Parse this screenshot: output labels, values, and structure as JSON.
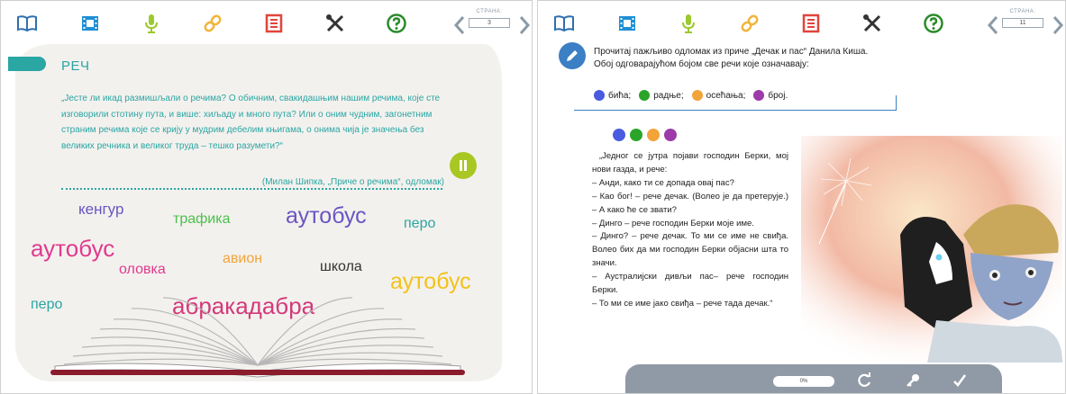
{
  "left": {
    "toolbar": {
      "icons": [
        "book-icon",
        "film-icon",
        "microphone-icon",
        "link-icon",
        "document-icon",
        "tools-icon",
        "help-icon"
      ],
      "colors": {
        "book": "#2e6fb0",
        "film": "#1e8fd6",
        "mic": "#9cc92e",
        "link": "#f2b43a",
        "doc": "#e2443a",
        "tools": "#333333",
        "help": "#2a8a2a"
      },
      "pager_label": "СТРАНА:",
      "pager_value": "3"
    },
    "section_title": "РЕЧ",
    "quote": "„Јесте ли икад размишљали о речима? О обичним, свакидашњим нашим речима, које сте изговорили стотину пута, и више: хиљаду и много пута? Или о оним чудним, загонетним страним речима које се крију у мудрим дебелим књигама, о онима чија је значења без великих речника и великог труда – тешко разумети?“",
    "attribution": "(Милан Шипка, „Приче о речима“, одломак)",
    "words": [
      {
        "text": "кенгур",
        "color": "#6a55c2"
      },
      {
        "text": "трафика",
        "color": "#4cc04c"
      },
      {
        "text": "аутобус",
        "color": "#6a55c2"
      },
      {
        "text": "перо",
        "color": "#2aa6a3"
      },
      {
        "text": "аутобус",
        "color": "#e03a8e"
      },
      {
        "text": "авион",
        "color": "#f2a43a"
      },
      {
        "text": "оловка",
        "color": "#e03a8e"
      },
      {
        "text": "школа",
        "color": "#333333"
      },
      {
        "text": "аутобус",
        "color": "#f2c21a"
      },
      {
        "text": "перо",
        "color": "#2aa6a3"
      },
      {
        "text": "абракадабра",
        "color": "#d4397a"
      }
    ]
  },
  "right": {
    "toolbar": {
      "pager_label": "СТРАНА:",
      "pager_value": "11"
    },
    "instruction_line1": "Прочитај пажљиво одломак из приче „Дечак и пас“ Данила Киша.",
    "instruction_line2": "Обој одговарајућом бојом све речи које означавају:",
    "legend": [
      {
        "label": "бића;",
        "color": "#4a5be0"
      },
      {
        "label": "радње;",
        "color": "#2aa52a"
      },
      {
        "label": "осећања;",
        "color": "#f2a43a"
      },
      {
        "label": "број.",
        "color": "#9b3aa8"
      }
    ],
    "story": [
      "„Једног се јутра појави господин Берки, мој нови газда, и рече:",
      "– Анди, како ти се допада овај пас?",
      "– Као бог! – рече дечак. (Волео је да претерује.) – А како ће се звати?",
      "– Динго – рече господин Берки моје име.",
      "– Динго? – рече дечак. То ми се име не свиђа. Волео бих да ми господин Берки објасни шта то значи.",
      "– Аустралијски дивљи пас– рече господин Берки.",
      "– То ми се име јако свиђа – рече тада дечак.“"
    ],
    "progress": "0%",
    "bottom_icons": [
      "refresh-icon",
      "key-icon",
      "check-icon"
    ]
  }
}
